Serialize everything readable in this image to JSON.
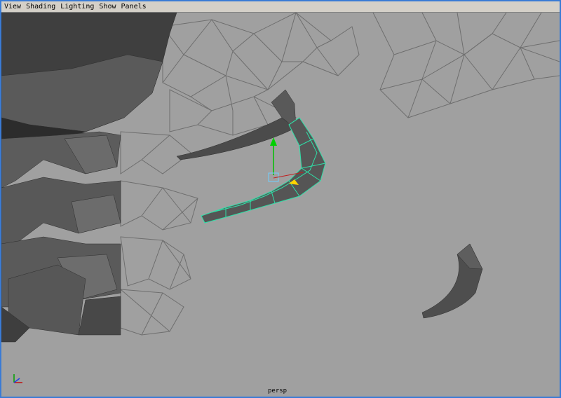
{
  "menu": {
    "items": [
      "View",
      "Shading",
      "Lighting",
      "Show",
      "Panels"
    ]
  },
  "viewport": {
    "camera_label": "persp",
    "background_color": "#a0a0a0",
    "wireframe_color": "#6f6f6f",
    "mesh_color": "#5a5a5a",
    "selection_color": "#2fe0a8"
  },
  "axis_gizmo": {
    "x_label": "x",
    "y_label": "y",
    "z_label": "z"
  }
}
